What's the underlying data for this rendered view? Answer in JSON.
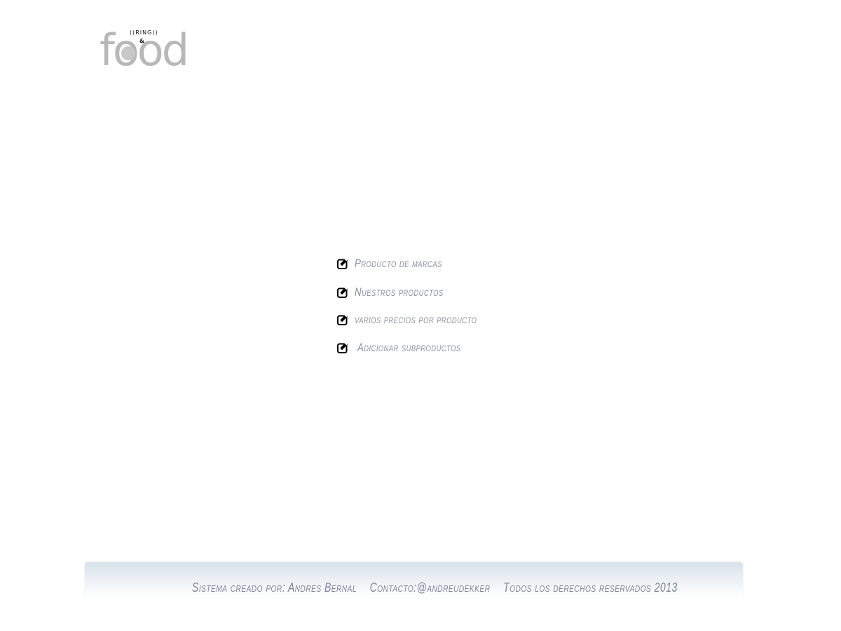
{
  "logo": {
    "ring_text": "((RING))",
    "amp_text": "&",
    "word": "food",
    "brand_color": "#b8b8b8"
  },
  "menu": {
    "items": [
      {
        "label": "Producto de marcas",
        "icon": "edit-icon"
      },
      {
        "label": "Nuestros productos",
        "icon": "edit-icon"
      },
      {
        "label": "varios precios por producto",
        "icon": "edit-icon"
      },
      {
        "label": "Adicionar subproductos",
        "icon": "edit-icon"
      }
    ],
    "label_color": "#8a8ea0"
  },
  "footer": {
    "credit": "Sistema creado por: Andres Bernal",
    "contact": "Contacto:@andreudekker",
    "rights": "Todos los derechos reservados  2013",
    "text_color": "#7f8499"
  }
}
